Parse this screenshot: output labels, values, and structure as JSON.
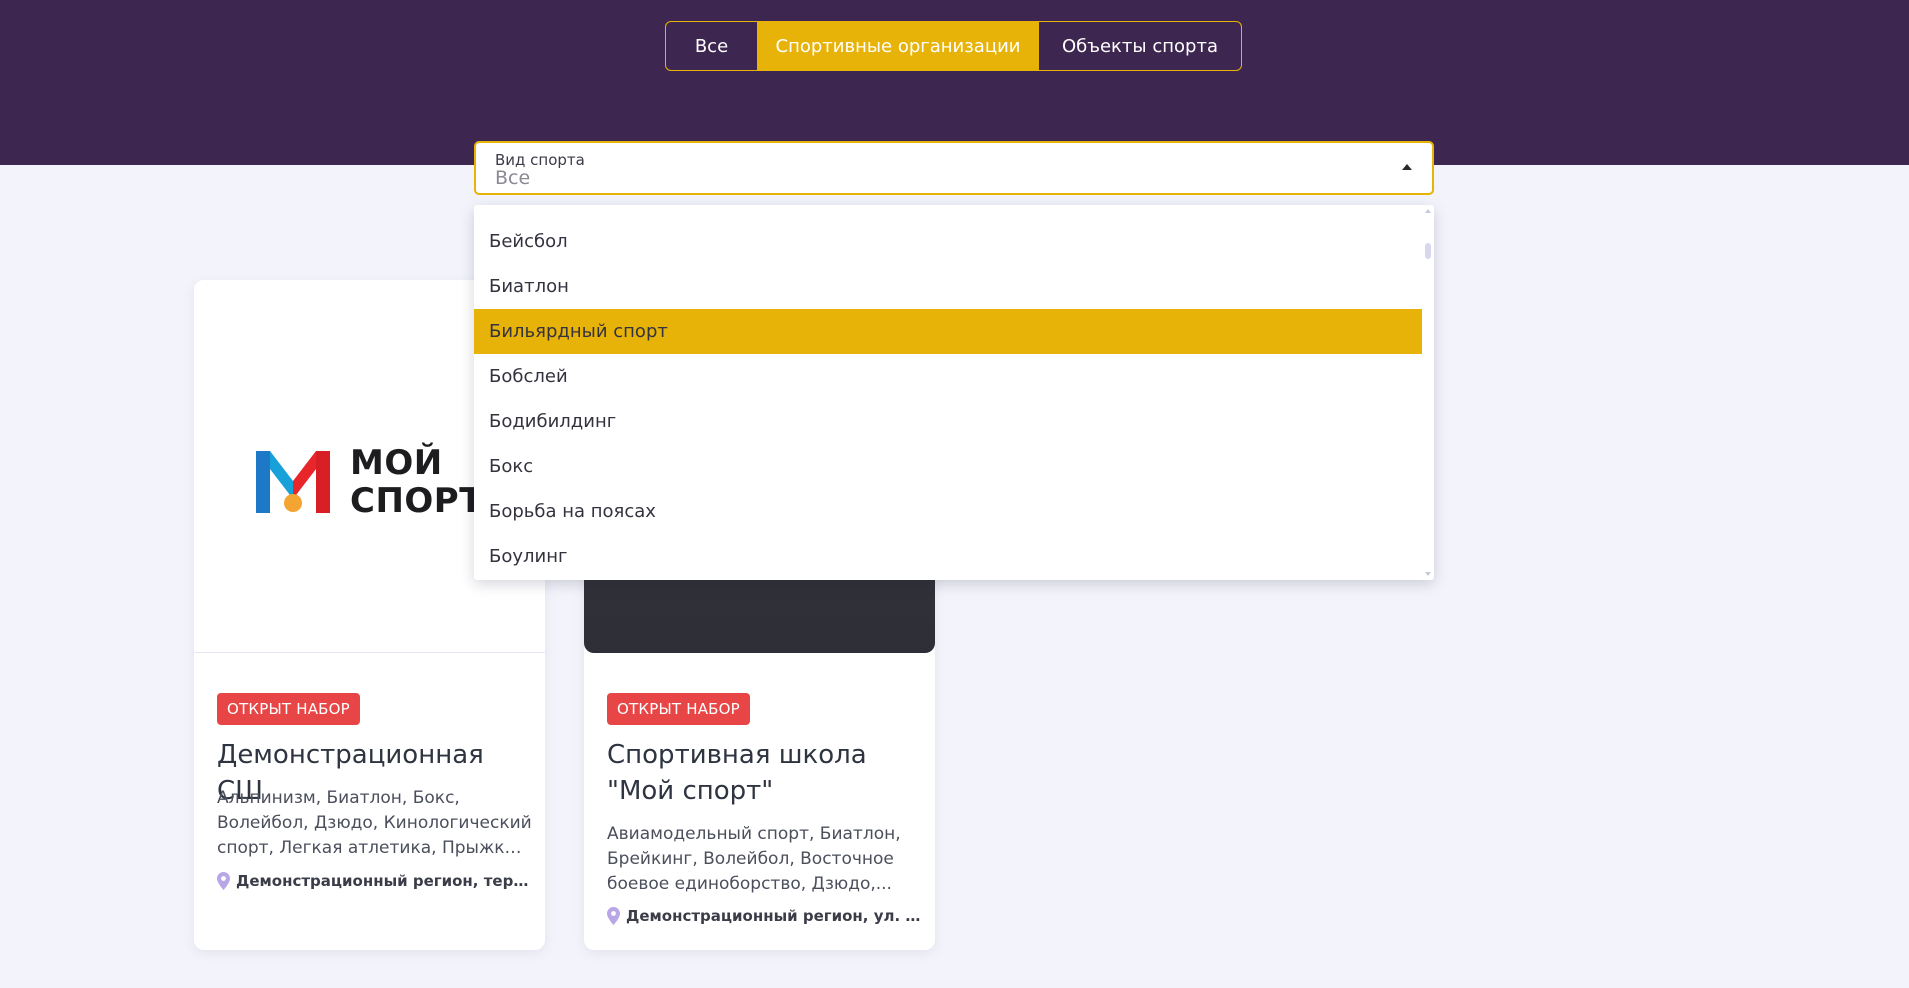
{
  "tabs": [
    {
      "label": "Все",
      "active": false
    },
    {
      "label": "Спортивные организации",
      "active": true
    },
    {
      "label": "Объекты спорта",
      "active": false
    }
  ],
  "filter": {
    "label": "Вид спорта",
    "value": "Все",
    "caret_icon": "caret-up-icon"
  },
  "dropdown": {
    "items": [
      {
        "label": "Бейсбол",
        "active": false
      },
      {
        "label": "Биатлон",
        "active": false
      },
      {
        "label": "Бильярдный спорт",
        "active": true
      },
      {
        "label": "Бобслей",
        "active": false
      },
      {
        "label": "Бодибилдинг",
        "active": false
      },
      {
        "label": "Бокс",
        "active": false
      },
      {
        "label": "Борьба на поясах",
        "active": false
      },
      {
        "label": "Боулинг",
        "active": false
      }
    ]
  },
  "cards": [
    {
      "logo_text_line1": "МОЙ",
      "logo_text_line2": "СПОРТ",
      "badge": "ОТКРЫТ НАБОР",
      "title": "Демонстрационная СШ",
      "sports": "Альпинизм, Биатлон, Бокс, Волейбол, Дзюдо, Кинологический спорт, Легкая атлетика, Прыжки ...",
      "address": "Демонстрационный регион, террит..."
    },
    {
      "badge": "ОТКРЫТ НАБОР",
      "title": "Спортивная школа \"Мой спорт\"",
      "sports": "Авиамодельный спорт, Биатлон, Брейкинг, Волейбол, Восточное боевое единоборство, Дзюдо,...",
      "address": "Демонстрационный регион, ул. Гага..."
    }
  ],
  "colors": {
    "header": "#3d2750",
    "accent": "#e8b308",
    "badge": "#e84646",
    "background": "#f3f4fb"
  }
}
